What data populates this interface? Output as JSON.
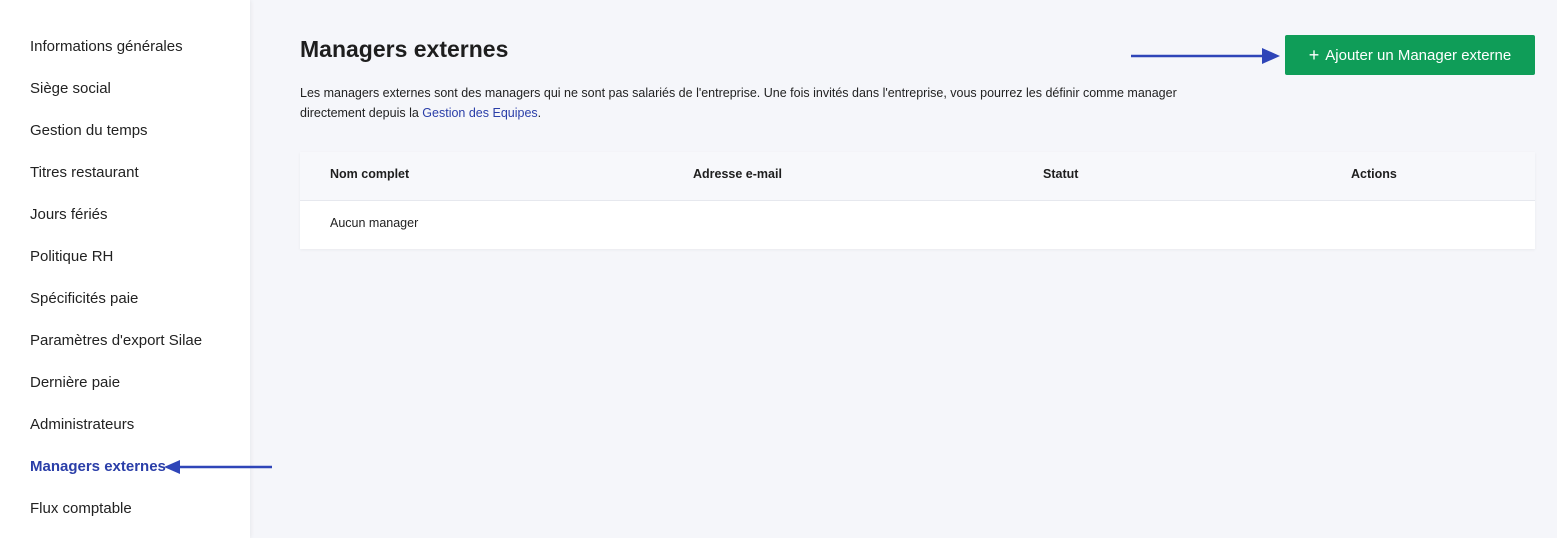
{
  "sidebar": {
    "items": [
      {
        "label": "Informations générales",
        "active": false
      },
      {
        "label": "Siège social",
        "active": false
      },
      {
        "label": "Gestion du temps",
        "active": false
      },
      {
        "label": "Titres restaurant",
        "active": false
      },
      {
        "label": "Jours fériés",
        "active": false
      },
      {
        "label": "Politique RH",
        "active": false
      },
      {
        "label": "Spécificités paie",
        "active": false
      },
      {
        "label": "Paramètres d'export Silae",
        "active": false
      },
      {
        "label": "Dernière paie",
        "active": false
      },
      {
        "label": "Administrateurs",
        "active": false
      },
      {
        "label": "Managers externes",
        "active": true
      },
      {
        "label": "Flux comptable",
        "active": false
      }
    ]
  },
  "main": {
    "title": "Managers externes",
    "description_prefix": "Les managers externes sont des managers qui ne sont pas salariés de l'entreprise. Une fois invités dans l'entreprise, vous pourrez les définir comme manager directement depuis la ",
    "description_link": "Gestion des Equipes",
    "description_suffix": ".",
    "add_button": {
      "icon": "plus-icon",
      "label": "Ajouter un Manager externe"
    },
    "table": {
      "columns": [
        "Nom complet",
        "Adresse e-mail",
        "Statut",
        "Actions"
      ],
      "empty_text": "Aucun manager"
    }
  },
  "colors": {
    "accent": "#2a3ea8",
    "button_green": "#0f9d58",
    "annotation_arrow": "#2f45b8"
  }
}
